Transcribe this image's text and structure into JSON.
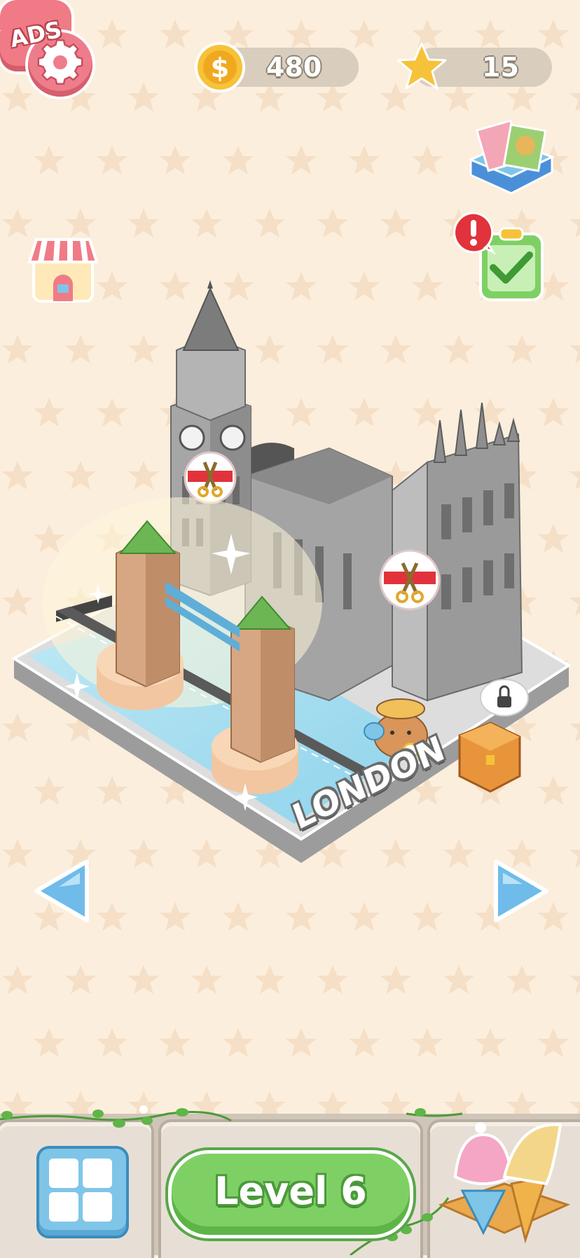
{
  "top_bar": {
    "coins": "480",
    "stars": "15"
  },
  "scene": {
    "city_name": "LONDON"
  },
  "side_buttons": {
    "ads_label": "ADS"
  },
  "bottom_bar": {
    "level_label": "Level 6"
  },
  "colors": {
    "background": "#fbeedd",
    "accent_red": "#ee7d8b",
    "level_green": "#7fd064",
    "arrow_blue": "#6fbbe9",
    "coin_gold": "#f6c23a"
  }
}
